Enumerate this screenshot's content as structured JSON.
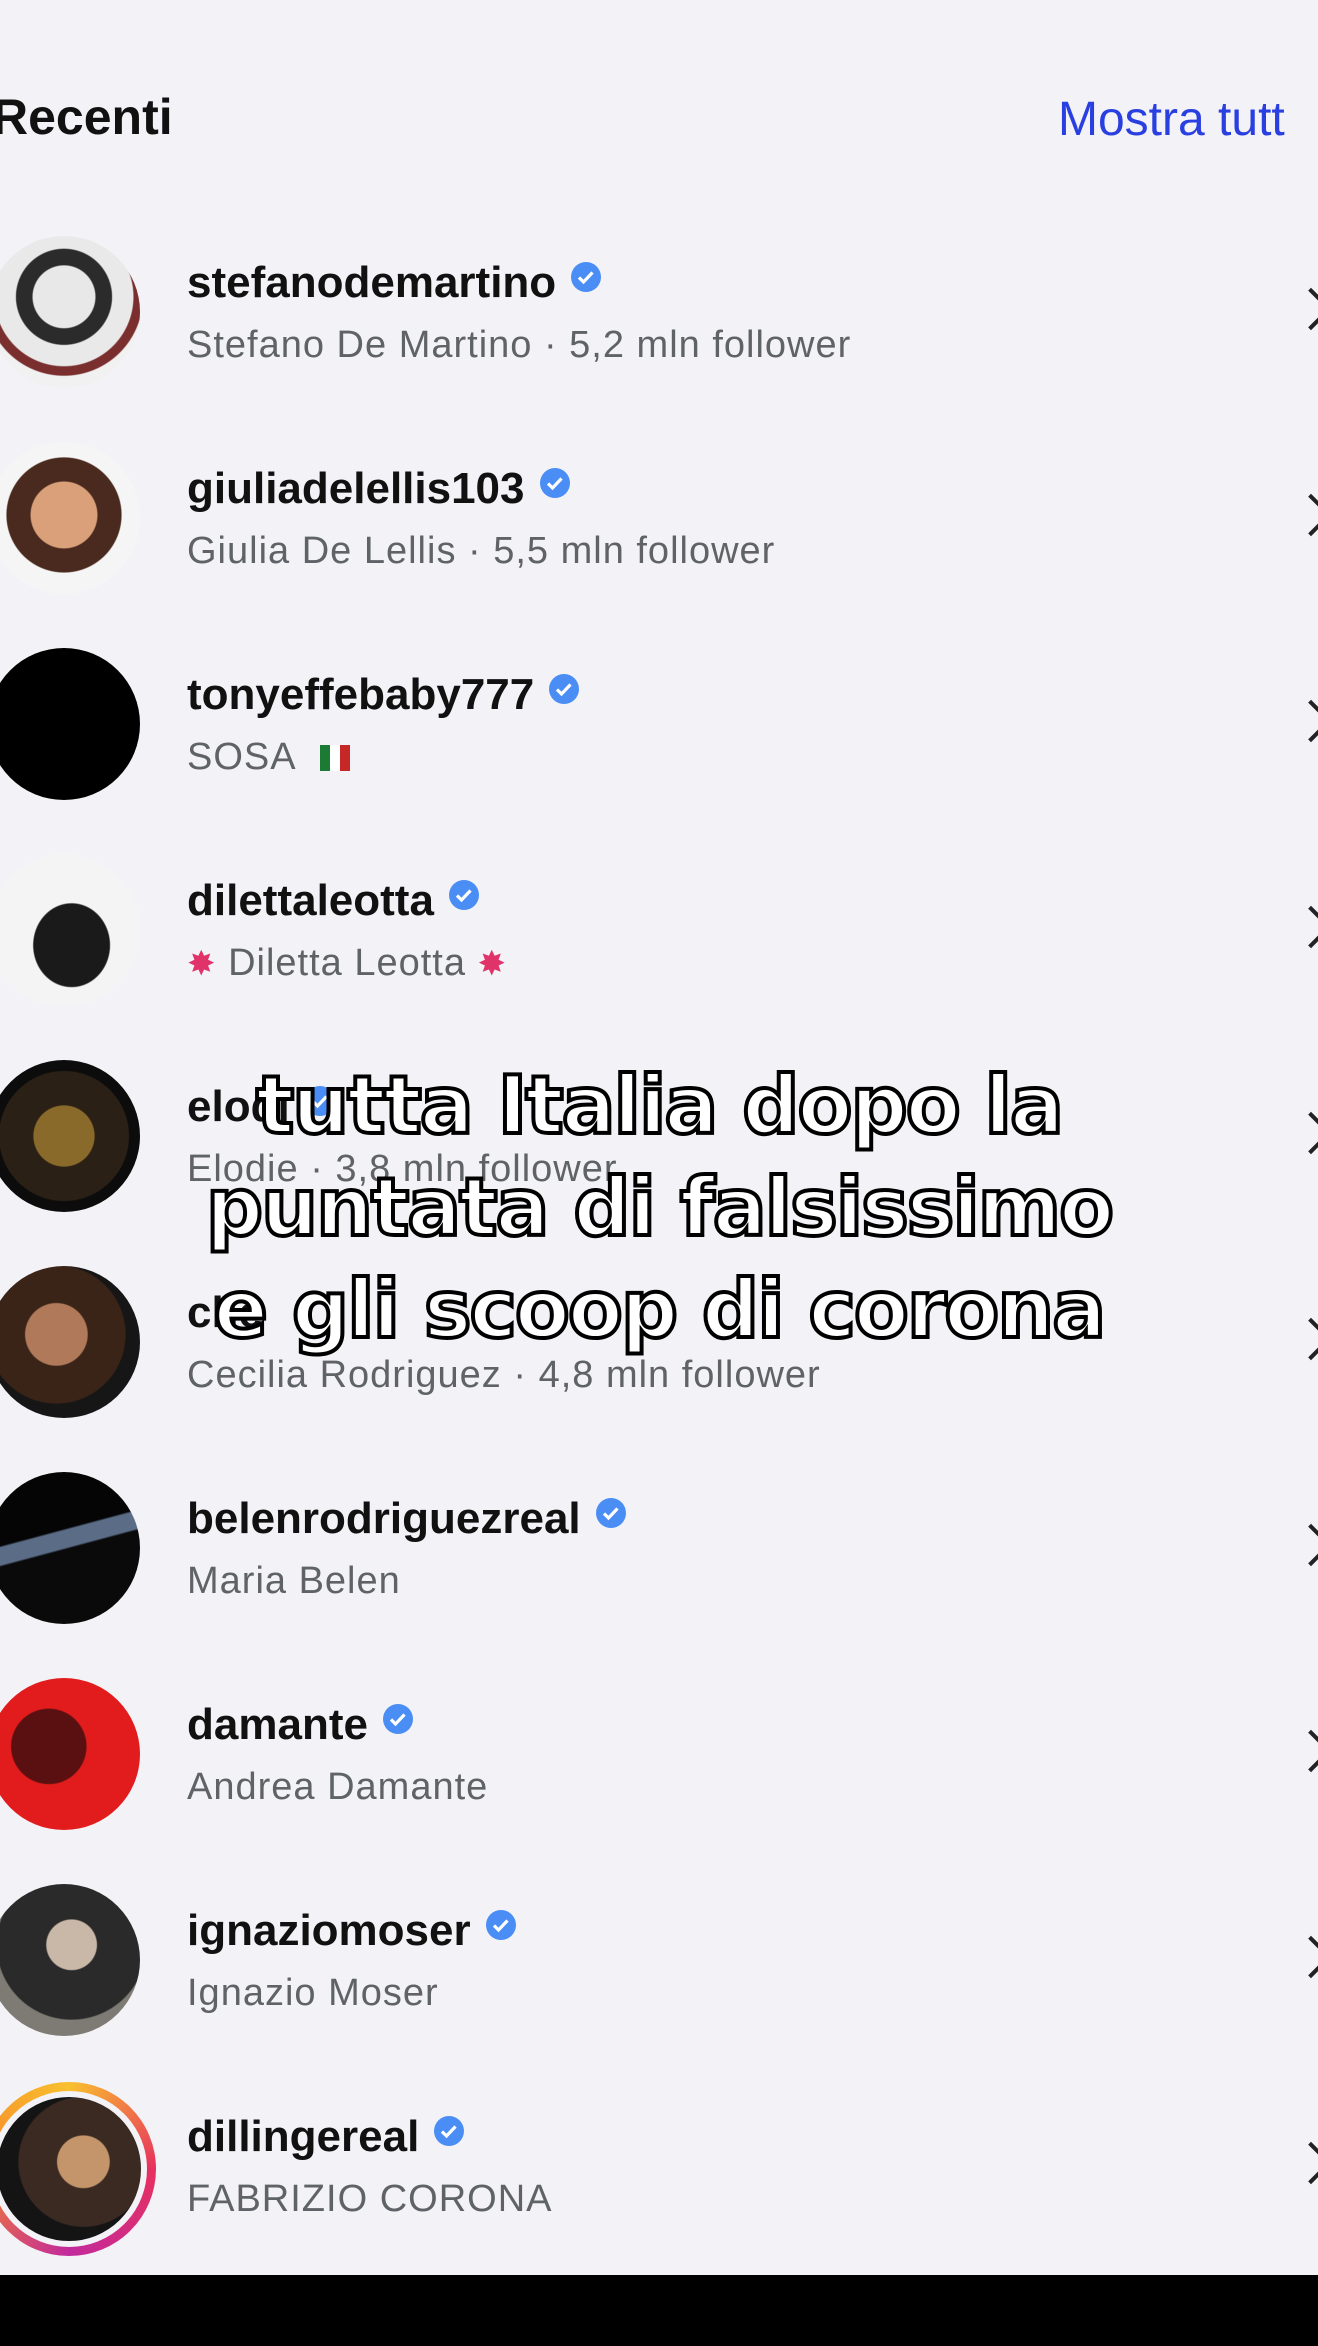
{
  "header": {
    "title": "Recenti",
    "link": "Mostra tutt"
  },
  "accounts": [
    {
      "username": "stefanodemartino",
      "verified": true,
      "subtitle": "Stefano De Martino · 5,2 mln follower",
      "avatar": "portrait-bw"
    },
    {
      "username": "giuliadelellis103",
      "verified": true,
      "subtitle": "Giulia De Lellis · 5,5 mln follower",
      "avatar": "portrait-color"
    },
    {
      "username": "tonyeffebaby777",
      "verified": true,
      "subtitle": "SOSA",
      "avatar": "black-circle",
      "flag": "italy-flag"
    },
    {
      "username": "dilettaleotta",
      "verified": true,
      "subtitle": "Diletta Leotta",
      "avatar": "portrait-seated",
      "decor": "sparkle-emoji"
    },
    {
      "username": "elodi",
      "verified": true,
      "subtitle": "Elodie · 3,8 mln follower",
      "avatar": "portrait-dark"
    },
    {
      "username": "che",
      "verified": false,
      "subtitle": "Cecilia Rodriguez · 4,8 mln follower",
      "avatar": "portrait-dark"
    },
    {
      "username": "belenrodriguezreal",
      "verified": true,
      "subtitle": "Maria Belen",
      "avatar": "portrait-night"
    },
    {
      "username": "damante",
      "verified": true,
      "subtitle": "Andrea Damante",
      "avatar": "portrait-red"
    },
    {
      "username": "ignaziomoser",
      "verified": true,
      "subtitle": "Ignazio Moser",
      "avatar": "portrait-grey"
    },
    {
      "username": "dillingereal",
      "verified": true,
      "subtitle": "FABRIZIO CORONA",
      "avatar": "story-ring-portrait"
    }
  ],
  "overlay": {
    "lines": [
      "tutta Italia dopo la",
      "puntata di falsissimo",
      "e gli scoop di corona"
    ]
  },
  "colors": {
    "background": "#f3f2f7",
    "link": "#2a3fe0",
    "verified": "#4a8ef5",
    "subtitle": "#5f6368"
  }
}
